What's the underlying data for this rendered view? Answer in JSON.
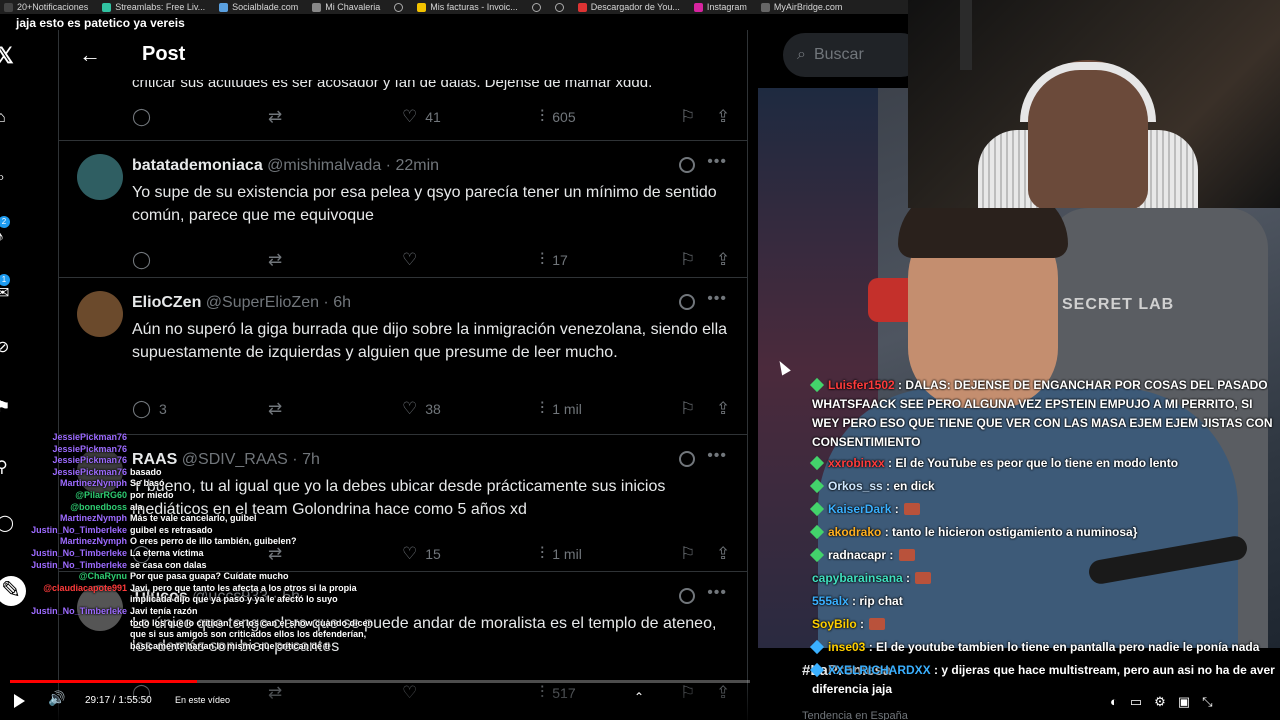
{
  "stream_title": "jaja esto es patetico ya vereis",
  "bookmarks": [
    {
      "label": "20+Notificaciones",
      "color": "#444"
    },
    {
      "label": "Streamlabs: Free Liv...",
      "color": "#31c3a2"
    },
    {
      "label": "Socialblade.com",
      "color": "#5aa0e0"
    },
    {
      "label": "Mi Chavaleria",
      "color": "#888"
    },
    {
      "label": "",
      "color": ""
    },
    {
      "label": "Mis facturas - Invoic...",
      "color": "#f2c200"
    },
    {
      "label": "",
      "color": ""
    },
    {
      "label": "",
      "color": ""
    },
    {
      "label": "Descargador de You...",
      "color": "#d33"
    },
    {
      "label": "Instagram",
      "color": "#d6249f"
    },
    {
      "label": "MyAirBridge.com",
      "color": "#666"
    }
  ],
  "header": {
    "back_icon": "arrow-left-icon",
    "title": "Post"
  },
  "search": {
    "placeholder": "Buscar"
  },
  "nav_badges": [
    "2",
    "1"
  ],
  "cut_text": "criticar sus actitudes es ser acosador y fan de dalas. Dejense de mamar xddd.",
  "first_actions": {
    "likes": "41",
    "views": "605"
  },
  "tweets": [
    {
      "name": "batatademoniaca",
      "handle": "@mishimalvada",
      "time": "22min",
      "body": "Yo supe de su existencia por esa pelea y qsyo parecía tener un mínimo de sentido común, parece que me equivoque",
      "replies": "",
      "retweets": "",
      "likes": "",
      "views": "17",
      "avatar_color": "#2f5e62"
    },
    {
      "name": "ElioCZen",
      "handle": "@SuperElioZen",
      "time": "6h",
      "body": "Aún no superó la giga burrada que dijo sobre la inmigración venezolana, siendo ella supuestamente de izquierdas y alguien que presume de leer mucho.",
      "replies": "3",
      "retweets": "",
      "likes": "38",
      "views": "1 mil",
      "avatar_color": "#6b4a2c"
    },
    {
      "name": "RAAS",
      "handle": "@SDIV_RAAS",
      "time": "7h",
      "body": "Y bueno, tu al igual que yo la debes ubicar desde prácticamente sus inicios mediáticos en el team Golondrina hace como 5 años xd",
      "replies": "",
      "retweets": "",
      "likes": "15",
      "views": "1 mil",
      "avatar_color": "#3c3c3c"
    },
    {
      "name": "Tilucos",
      "handle": "@uccs933",
      "time": "5h",
      "body": "Lo único que tengo claro que se puede andar de moralista es el templo de ateneo, los demás son bien pecantes",
      "replies": "",
      "retweets": "",
      "likes": "",
      "views": "517",
      "avatar_color": "#555"
    }
  ],
  "chat_big": [
    {
      "user": "Luisfer1502",
      "color": "#ff3b3b",
      "text": "DALAS: DEJENSE DE ENGANCHAR POR COSAS DEL PASADO WHATSFAACK SEE PERO ALGUNA VEZ EPSTEIN EMPUJO A MI PERRITO, SI WEY PERO ESO QUE TIENE QUE VER CON LAS MASA EJEM EJEM JISTAS CON CONSENTIMIENTO",
      "emote": false,
      "badge": "green"
    },
    {
      "user": "xxrobinxx",
      "color": "#ff3b3b",
      "text": "El de YouTube es peor que lo tiene en modo lento",
      "emote": false,
      "badge": "green"
    },
    {
      "user": "Orkos_ss",
      "color": "#cfe8ff",
      "text": "en dick",
      "emote": false,
      "badge": "green"
    },
    {
      "user": "KaiserDark",
      "color": "#3ab0ff",
      "text": "",
      "emote": true,
      "badge": "green"
    },
    {
      "user": "akodrako",
      "color": "#ffb020",
      "text": "tanto le hicieron ostigamiento a numinosa}",
      "emote": false,
      "badge": "green"
    },
    {
      "user": "radnacapr",
      "color": "#ffffff",
      "text": "",
      "emote": true,
      "badge": "green"
    },
    {
      "user": "capybarainsana",
      "color": "#40e0c0",
      "text": "",
      "emote": true,
      "badge": ""
    },
    {
      "user": "555alx",
      "color": "#3ab0ff",
      "text": "rip chat",
      "emote": false,
      "badge": ""
    },
    {
      "user": "SoyBilo",
      "color": "#ffd000",
      "text": "",
      "emote": true,
      "badge": ""
    },
    {
      "user": "inse03",
      "color": "#ffd000",
      "text": "El de youtube tambien lo tiene en pantalla pero nadie le ponía nada",
      "emote": false,
      "badge": "blue"
    },
    {
      "user": "XXELRICHARDXX",
      "color": "#3ab0ff",
      "text": "y dijeras que hace multistream, pero aun asi no ha de aver diferencia jaja",
      "emote": false,
      "badge": "blue"
    }
  ],
  "chat_small": [
    {
      "user": "JessiePickman76",
      "color": "#9d6bff",
      "text": ""
    },
    {
      "user": "JessiePickman76",
      "color": "#9d6bff",
      "text": ""
    },
    {
      "user": "JessiePickman76",
      "color": "#9d6bff",
      "text": ""
    },
    {
      "user": "JessiePickman76",
      "color": "#9d6bff",
      "text": "basado"
    },
    {
      "user": "MartinezNymph",
      "color": "#9d6bff",
      "text": "Se basó"
    },
    {
      "user": "@PilarRG60",
      "color": "#2ecc71",
      "text": "por miedo"
    },
    {
      "user": "@bonedboss",
      "color": "#2ecc71",
      "text": "ala"
    },
    {
      "user": "MartinezNymph",
      "color": "#9d6bff",
      "text": "Más te vale cancelarlo, guibel"
    },
    {
      "user": "Justin_No_Timberleke",
      "color": "#9d6bff",
      "text": "guibel es retrasado"
    },
    {
      "user": "MartinezNymph",
      "color": "#9d6bff",
      "text": "O eres perro de illo también, guibelen?"
    },
    {
      "user": "Justin_No_Timberleke",
      "color": "#9d6bff",
      "text": "La eterna víctima"
    },
    {
      "user": "Justin_No_Timberleke",
      "color": "#9d6bff",
      "text": "se casa con dalas"
    },
    {
      "user": "@ChaRynu",
      "color": "#2ecc71",
      "text": "Por que pasa guapa? Cuídate mucho"
    },
    {
      "user": "@claudiacapote991",
      "color": "#ff3b3b",
      "text": "Javi, pero que tanto les afecta a los otros si la propia"
    },
    {
      "user": "",
      "color": "#ff3b3b",
      "text": "implicada dijo que ya pasó y ya le afectó lo suyo"
    },
    {
      "user": "Justin_No_Timberleke",
      "color": "#9d6bff",
      "text": "Javi tenía razón"
    },
    {
      "user": "",
      "color": "#9d6bff",
      "text": "todo los que lo critican, se los can el show cuando dicen"
    },
    {
      "user": "",
      "color": "#9d6bff",
      "text": "que si sus amigos son criticados ellos los defenderían,"
    },
    {
      "user": "",
      "color": "#9d6bff",
      "text": "básicamente harían lo mismo que critican de ti"
    }
  ],
  "trend": {
    "label": "#LaPromesa",
    "sub": "Tendencia en España"
  },
  "player": {
    "time": "29:17 / 1:55:50",
    "in_video": "En este vídeo",
    "progress": 0.253
  },
  "webcam_brand": "SECRET LAB"
}
